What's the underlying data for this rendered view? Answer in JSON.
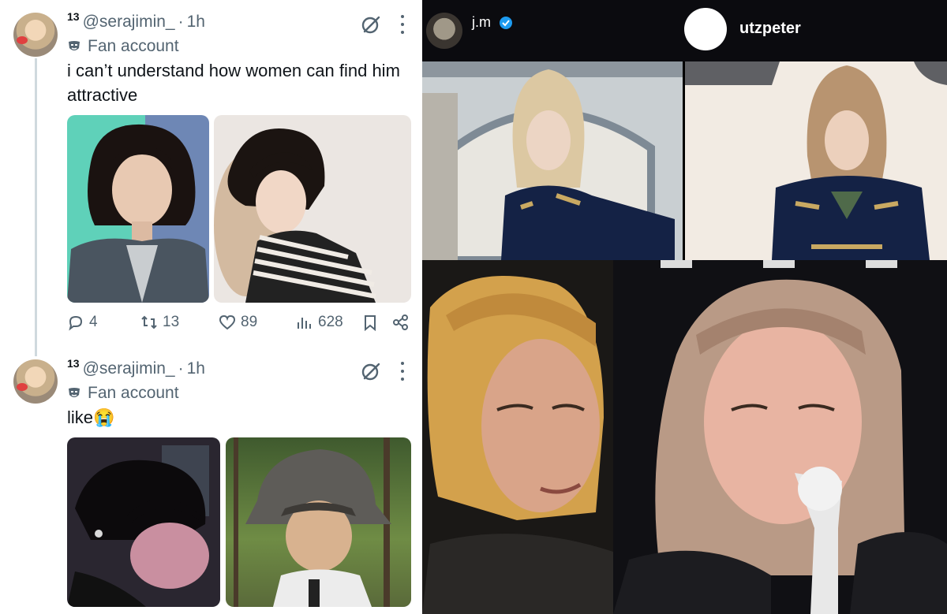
{
  "tweets": [
    {
      "badge": "13",
      "handle": "@serajimin_",
      "separator": "·",
      "time": "1h",
      "fan_label": "Fan account",
      "text": "i can’t understand how women can find him attractive",
      "stats": {
        "replies": "4",
        "reposts": "13",
        "likes": "89",
        "views": "628"
      }
    },
    {
      "badge": "13",
      "handle": "@serajimin_",
      "separator": "·",
      "time": "1h",
      "fan_label": "Fan account",
      "text": "like😭"
    }
  ],
  "instagram": {
    "left_username": "j.m",
    "right_username": "utzpeter"
  },
  "icons": {
    "reply": "reply-icon",
    "repost": "repost-icon",
    "like": "heart-icon",
    "views": "views-icon",
    "bookmark": "bookmark-icon",
    "share": "share-icon",
    "grok": "grok-icon",
    "more": "more-icon",
    "verified": "verified-badge-icon"
  },
  "colors": {
    "text_primary": "#0f1419",
    "text_secondary": "#536471",
    "thread_line": "#cfd9de",
    "verified": "#1d9bf0"
  }
}
